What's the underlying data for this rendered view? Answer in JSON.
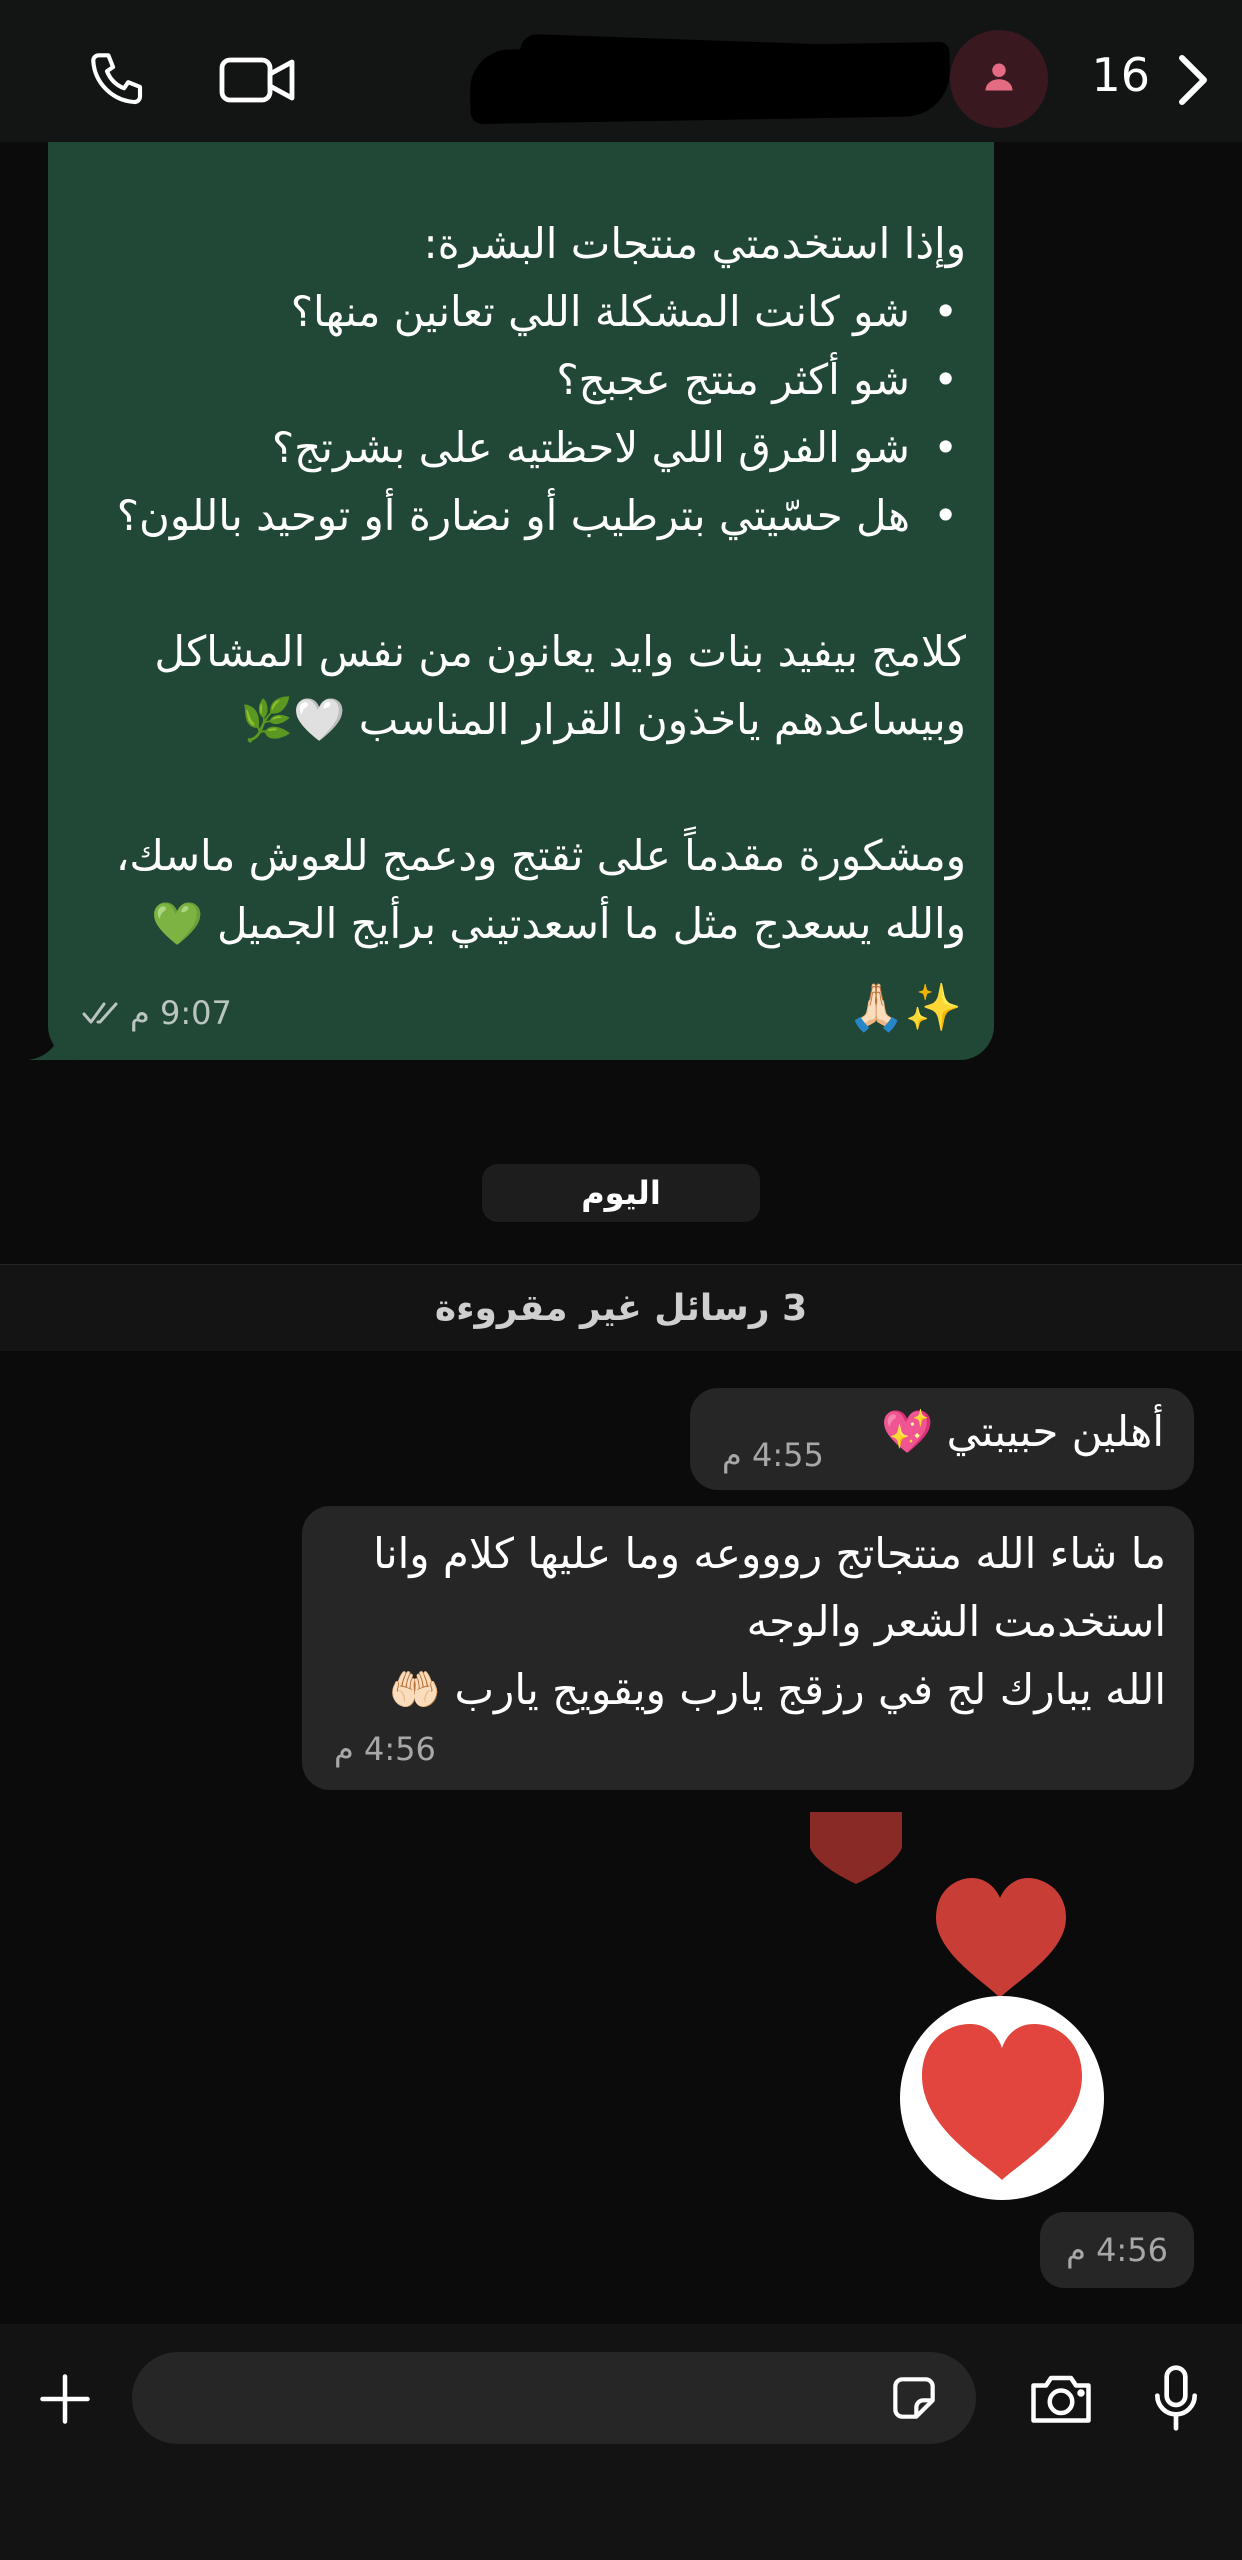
{
  "header": {
    "back_count": "16",
    "contact_name": "",
    "icons": [
      "chevron-right-icon",
      "person-icon",
      "video-camera-icon",
      "phone-icon"
    ]
  },
  "messages": {
    "green": {
      "intro": "وإذا استخدمتي منتجات البشرة:",
      "bullets": [
        "شو كانت المشكلة اللي تعانين منها؟",
        "شو أكثر منتج عجبج؟",
        "شو الفرق اللي لاحظتيه على بشرتج؟",
        "هل حسّيتي بترطيب أو نضارة أو توحيد باللون؟"
      ],
      "para1": "كلامج بيفيد بنات وايد يعانون من نفس المشاكل\nوبيساعدهم ياخذون القرار المناسب 🤍🌿",
      "para2": "ومشكورة مقدماً على ثقتج ودعمج للعوش ماسك،\nوالله يسعدج مثل ما أسعدتيني برأيج الجميل 💚",
      "emoji_line": "🙏🏻✨",
      "time": "9:07 م"
    },
    "date_label": "اليوم",
    "unread_label": "3 رسائل غير مقروءة",
    "incoming": [
      {
        "text": "أهلين حبيبتي 💖",
        "time": "4:55 م"
      },
      {
        "text": "ما شاء الله منتجاتج روووعه وما عليها كلام وانا\nاستخدمت الشعر والوجه\nالله يبارك لج في رزقج يارب ويقويج يارب 🤲🏻",
        "time": "4:56 م"
      }
    ],
    "sticker_time": "4:56 م"
  },
  "footer": {
    "input_placeholder": "",
    "icons": [
      "plus-icon",
      "sticker-icon",
      "camera-icon",
      "microphone-icon"
    ]
  },
  "colors": {
    "header_bg": "#131515",
    "chat_bg": "#0b0b0b",
    "green_bubble": "#214737",
    "gray_bubble": "#262626",
    "heart_red": "#e2453e"
  }
}
